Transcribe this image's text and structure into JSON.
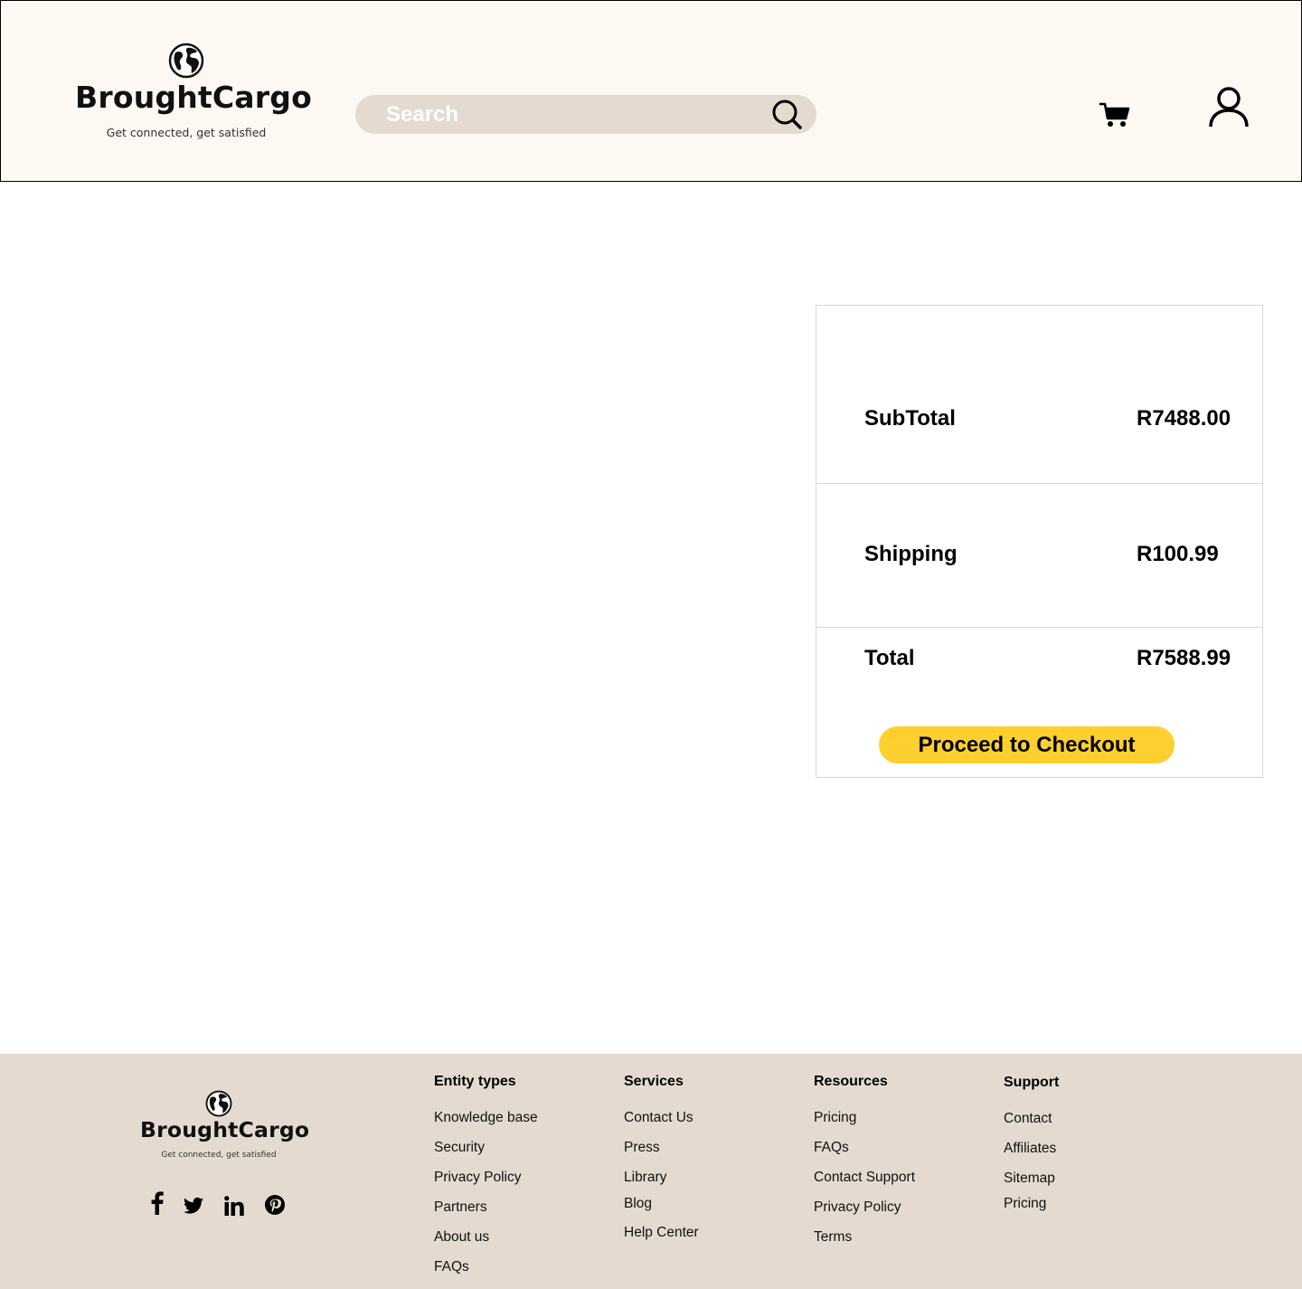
{
  "header": {
    "brand": "BroughtCargo",
    "tagline": "Get connected, get satisfied",
    "search_placeholder": "Search",
    "icons": [
      "globe-icon",
      "search-icon",
      "cart-icon",
      "user-icon"
    ]
  },
  "summary": {
    "subtotal_label": "SubTotal",
    "subtotal_value": "R7488.00",
    "shipping_label": "Shipping",
    "shipping_value": "R100.99",
    "total_label": "Total",
    "total_value": "R7588.99",
    "checkout_label": "Proceed to Checkout"
  },
  "footer": {
    "brand": "BroughtCargo",
    "tagline": "Get connected, get satisfied",
    "social": [
      "facebook-icon",
      "twitter-icon",
      "linkedin-icon",
      "pinterest-icon"
    ],
    "columns": [
      {
        "title": "Entity types",
        "links": [
          "Knowledge base",
          "Security",
          "Privacy Policy",
          "Partners",
          "About us",
          "FAQs"
        ]
      },
      {
        "title": "Services",
        "links": [
          "Contact Us",
          "Press",
          "Library",
          "Blog",
          "Help Center"
        ]
      },
      {
        "title": "Resources",
        "links": [
          "Pricing",
          "FAQs",
          "Contact Support",
          "Privacy Policy",
          "Terms"
        ]
      },
      {
        "title": "Support",
        "links": [
          "Contact",
          "Affiliates",
          "Sitemap",
          "Pricing"
        ]
      }
    ]
  },
  "colors": {
    "header_bg": "#fdf8f2",
    "search_bg": "#e4dad0",
    "accent_yellow": "#fecf2f",
    "footer_bg": "#e4dad0",
    "divider": "#d6d6d6"
  }
}
